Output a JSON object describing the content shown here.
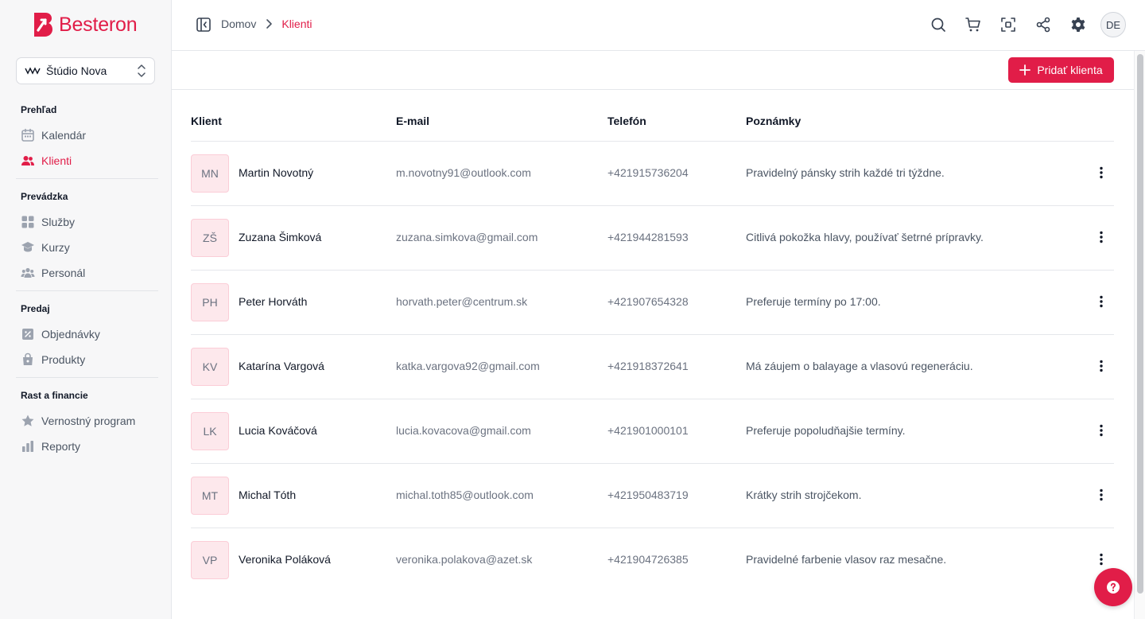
{
  "brand": {
    "name": "Besteron",
    "accent": "#e11d48"
  },
  "studio": {
    "name": "Štúdio Nova"
  },
  "sidebar": {
    "sections": [
      {
        "title": "Prehľad",
        "items": [
          {
            "label": "Kalendár",
            "icon": "calendar-icon"
          },
          {
            "label": "Klienti",
            "icon": "users-icon",
            "active": true
          }
        ]
      },
      {
        "title": "Prevádzka",
        "items": [
          {
            "label": "Služby",
            "icon": "grid-icon"
          },
          {
            "label": "Kurzy",
            "icon": "graduation-cap-icon"
          },
          {
            "label": "Personál",
            "icon": "team-icon"
          }
        ]
      },
      {
        "title": "Predaj",
        "items": [
          {
            "label": "Objednávky",
            "icon": "receipt-percent-icon"
          },
          {
            "label": "Produkty",
            "icon": "shopping-bag-icon"
          }
        ]
      },
      {
        "title": "Rast a financie",
        "items": [
          {
            "label": "Vernostný program",
            "icon": "star-icon"
          },
          {
            "label": "Reporty",
            "icon": "bar-chart-icon"
          }
        ]
      }
    ]
  },
  "breadcrumb": {
    "home": "Domov",
    "current": "Klienti"
  },
  "topbar": {
    "user_initials": "DE"
  },
  "actions": {
    "add_client": "Pridať klienta"
  },
  "table": {
    "headers": {
      "client": "Klient",
      "email": "E-mail",
      "phone": "Telefón",
      "notes": "Poznámky"
    },
    "rows": [
      {
        "initials": "MN",
        "name": "Martin Novotný",
        "email": "m.novotny91@outlook.com",
        "phone": "+421915736204",
        "note": "Pravidelný pánsky strih každé tri týždne."
      },
      {
        "initials": "ZŠ",
        "name": "Zuzana Šimková",
        "email": "zuzana.simkova@gmail.com",
        "phone": "+421944281593",
        "note": "Citlivá pokožka hlavy, používať šetrné prípravky."
      },
      {
        "initials": "PH",
        "name": "Peter Horváth",
        "email": "horvath.peter@centrum.sk",
        "phone": "+421907654328",
        "note": "Preferuje termíny po 17:00."
      },
      {
        "initials": "KV",
        "name": "Katarína Vargová",
        "email": "katka.vargova92@gmail.com",
        "phone": "+421918372641",
        "note": "Má záujem o balayage a vlasovú regeneráciu."
      },
      {
        "initials": "LK",
        "name": "Lucia Kováčová",
        "email": "lucia.kovacova@gmail.com",
        "phone": "+421901000101",
        "note": "Preferuje popoludňajšie termíny."
      },
      {
        "initials": "MT",
        "name": "Michal Tóth",
        "email": "michal.toth85@outlook.com",
        "phone": "+421950483719",
        "note": "Krátky strih strojčekom."
      },
      {
        "initials": "VP",
        "name": "Veronika Poláková",
        "email": "veronika.polakova@azet.sk",
        "phone": "+421904726385",
        "note": "Pravidelné farbenie vlasov raz mesačne."
      }
    ]
  }
}
